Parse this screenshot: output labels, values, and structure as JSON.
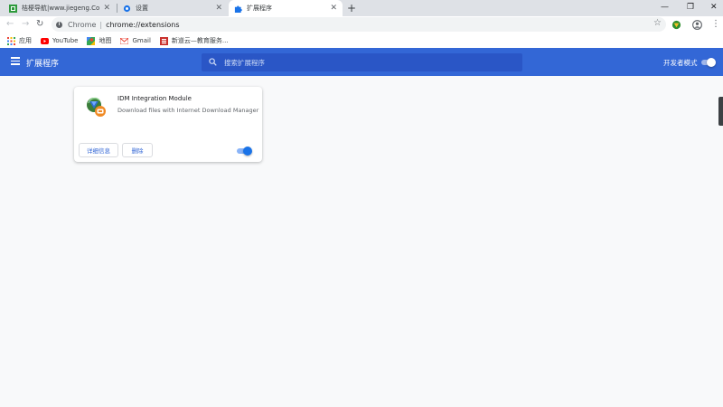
{
  "tabs": [
    {
      "title": "桔梗导航|www.jiegeng.Com|_名",
      "favicon": "jiegeng-favicon",
      "active": false
    },
    {
      "title": "设置",
      "favicon": "settings-icon",
      "active": false
    },
    {
      "title": "扩展程序",
      "favicon": "puzzle-icon",
      "active": true
    }
  ],
  "tab_close": "✕",
  "new_tab": "+",
  "window": {
    "minimize": "—",
    "restore": "❐",
    "close": "✕"
  },
  "toolbar": {
    "back": "←",
    "forward": "→",
    "reload": "↻",
    "scheme_label": "Chrome",
    "separator": "|",
    "url": "chrome://extensions",
    "star": "☆",
    "menu": "⋮"
  },
  "bookmarks": [
    {
      "label": "应用",
      "icon": "apps-grid-icon"
    },
    {
      "label": "YouTube",
      "icon": "youtube-icon"
    },
    {
      "label": "地图",
      "icon": "maps-icon"
    },
    {
      "label": "Gmail",
      "icon": "gmail-icon"
    },
    {
      "label": "新道云—教育服务...",
      "icon": "xindaoyun-icon"
    }
  ],
  "header": {
    "title": "扩展程序",
    "search_placeholder": "搜索扩展程序",
    "dev_mode_label": "开发者模式",
    "dev_mode_on": false,
    "color": "#3367d6"
  },
  "extension": {
    "name": "IDM Integration Module",
    "description": "Download files with Internet Download Manager",
    "details_button": "详细信息",
    "remove_button": "删除",
    "enabled": true
  }
}
